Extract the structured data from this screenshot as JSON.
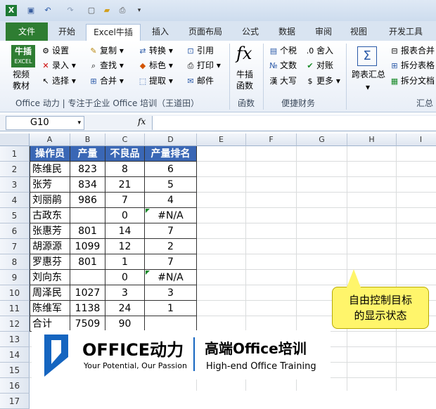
{
  "qat": {
    "icons": [
      "excel-logo-icon",
      "save-icon",
      "undo-icon",
      "redo-icon",
      "new-icon",
      "open-icon",
      "print-preview-icon",
      "customize-icon"
    ]
  },
  "tabs": [
    "文件",
    "开始",
    "Excel牛插",
    "插入",
    "页面布局",
    "公式",
    "数据",
    "审阅",
    "视图",
    "开发工具"
  ],
  "ribbon": {
    "niucha_logo": "牛插",
    "niucha_excel": "EXCEL",
    "video_l1": "视频",
    "video_l2": "教材",
    "settings": "设置",
    "copy": "复制",
    "convert": "转换",
    "reference": "引用",
    "record": "录入",
    "find": "查找",
    "color": "标色",
    "print": "打印",
    "select": "选择",
    "merge": "合并",
    "extract": "提取",
    "mail": "邮件",
    "group1_label": "Office 动力 | 专注于企业 Office 培训（王道田）",
    "func_l1": "牛插",
    "func_l2": "函数",
    "group2_label": "函数",
    "tax": "个税",
    "round": "舍入",
    "numtext": "文数",
    "verify": "对账",
    "caps": "大写",
    "more": "更多",
    "group3_label": "便捷财务",
    "summary": "跨表汇总",
    "report_merge": "报表合并",
    "split_table": "拆分表格",
    "split_doc": "拆分文档",
    "group4_label": "汇总"
  },
  "formula_bar": {
    "name_box": "G10",
    "fx": "fx",
    "content": ""
  },
  "columns": [
    "A",
    "B",
    "C",
    "D",
    "E",
    "F",
    "G",
    "H",
    "I"
  ],
  "rows": [
    "1",
    "2",
    "3",
    "4",
    "5",
    "6",
    "7",
    "8",
    "9",
    "10",
    "11",
    "12",
    "13",
    "14",
    "15",
    "16",
    "17"
  ],
  "table": {
    "headers": [
      "操作员",
      "产量",
      "不良品",
      "产量排名"
    ],
    "rows": [
      [
        "陈维民",
        "823",
        "8",
        "6"
      ],
      [
        "张芳",
        "834",
        "21",
        "5"
      ],
      [
        "刘丽鹃",
        "986",
        "7",
        "4"
      ],
      [
        "古政东",
        "",
        "0",
        "#N/A"
      ],
      [
        "张惠芳",
        "801",
        "14",
        "7"
      ],
      [
        "胡源源",
        "1099",
        "12",
        "2"
      ],
      [
        "罗惠芬",
        "801",
        "1",
        "7"
      ],
      [
        "刘向东",
        "",
        "0",
        "#N/A"
      ],
      [
        "周泽民",
        "1027",
        "3",
        "3"
      ],
      [
        "陈维军",
        "1138",
        "24",
        "1"
      ],
      [
        "合计",
        "7509",
        "90",
        ""
      ]
    ]
  },
  "callout": {
    "line1": "自由控制目标",
    "line2": "的显示状态"
  },
  "banner": {
    "brand": "OFFICE动力",
    "slogan": "Your Potential, Our Passion",
    "cn_title": "高端Office培训",
    "en_title": "High-end Office Training"
  },
  "colors": {
    "header_fill": "#3a67b5",
    "callout_fill": "#fff56b",
    "file_tab": "#2e7d32",
    "brand_blue": "#1565c0"
  }
}
